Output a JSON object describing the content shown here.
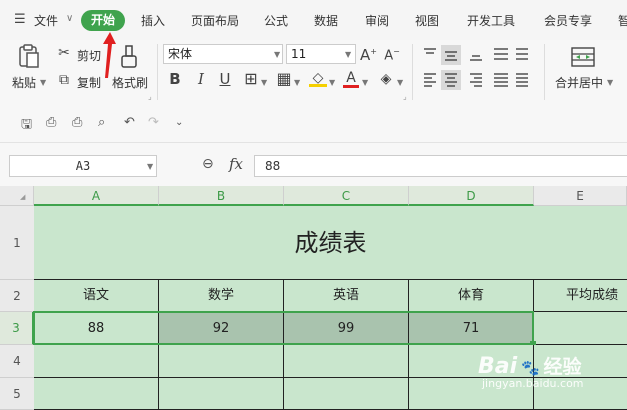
{
  "menu": {
    "file": "文件",
    "tabs": [
      "开始",
      "插入",
      "页面布局",
      "公式",
      "数据",
      "审阅",
      "视图",
      "开发工具",
      "会员专享",
      "智"
    ]
  },
  "ribbon": {
    "paste": "粘贴",
    "cut": "剪切",
    "copy": "复制",
    "format_painter": "格式刷",
    "font_name": "宋体",
    "font_size": "11",
    "merge_center": "合并居中",
    "bold": "B",
    "italic": "I",
    "underline": "U",
    "font_color_letter": "A",
    "grow_font": "A",
    "shrink_font": "A"
  },
  "colors": {
    "accent_green": "#3fa34d",
    "cell_fill": "#c9e6cd",
    "cell_selected_fill": "#a9c3ae",
    "red_arrow": "#e02020"
  },
  "formula_bar": {
    "name_box": "A3",
    "fx_label": "fx",
    "value": "88"
  },
  "sheet": {
    "columns": [
      "A",
      "B",
      "C",
      "D",
      "E"
    ],
    "rows": [
      "1",
      "2",
      "3",
      "4",
      "5"
    ],
    "title": "成绩表",
    "headers": [
      "语文",
      "数学",
      "英语",
      "体育",
      "平均成绩"
    ],
    "scores": [
      "88",
      "92",
      "99",
      "71",
      ""
    ]
  },
  "watermark": {
    "brand": "Bai",
    "brand_suffix": "经验",
    "url": "jingyan.baidu.com"
  }
}
